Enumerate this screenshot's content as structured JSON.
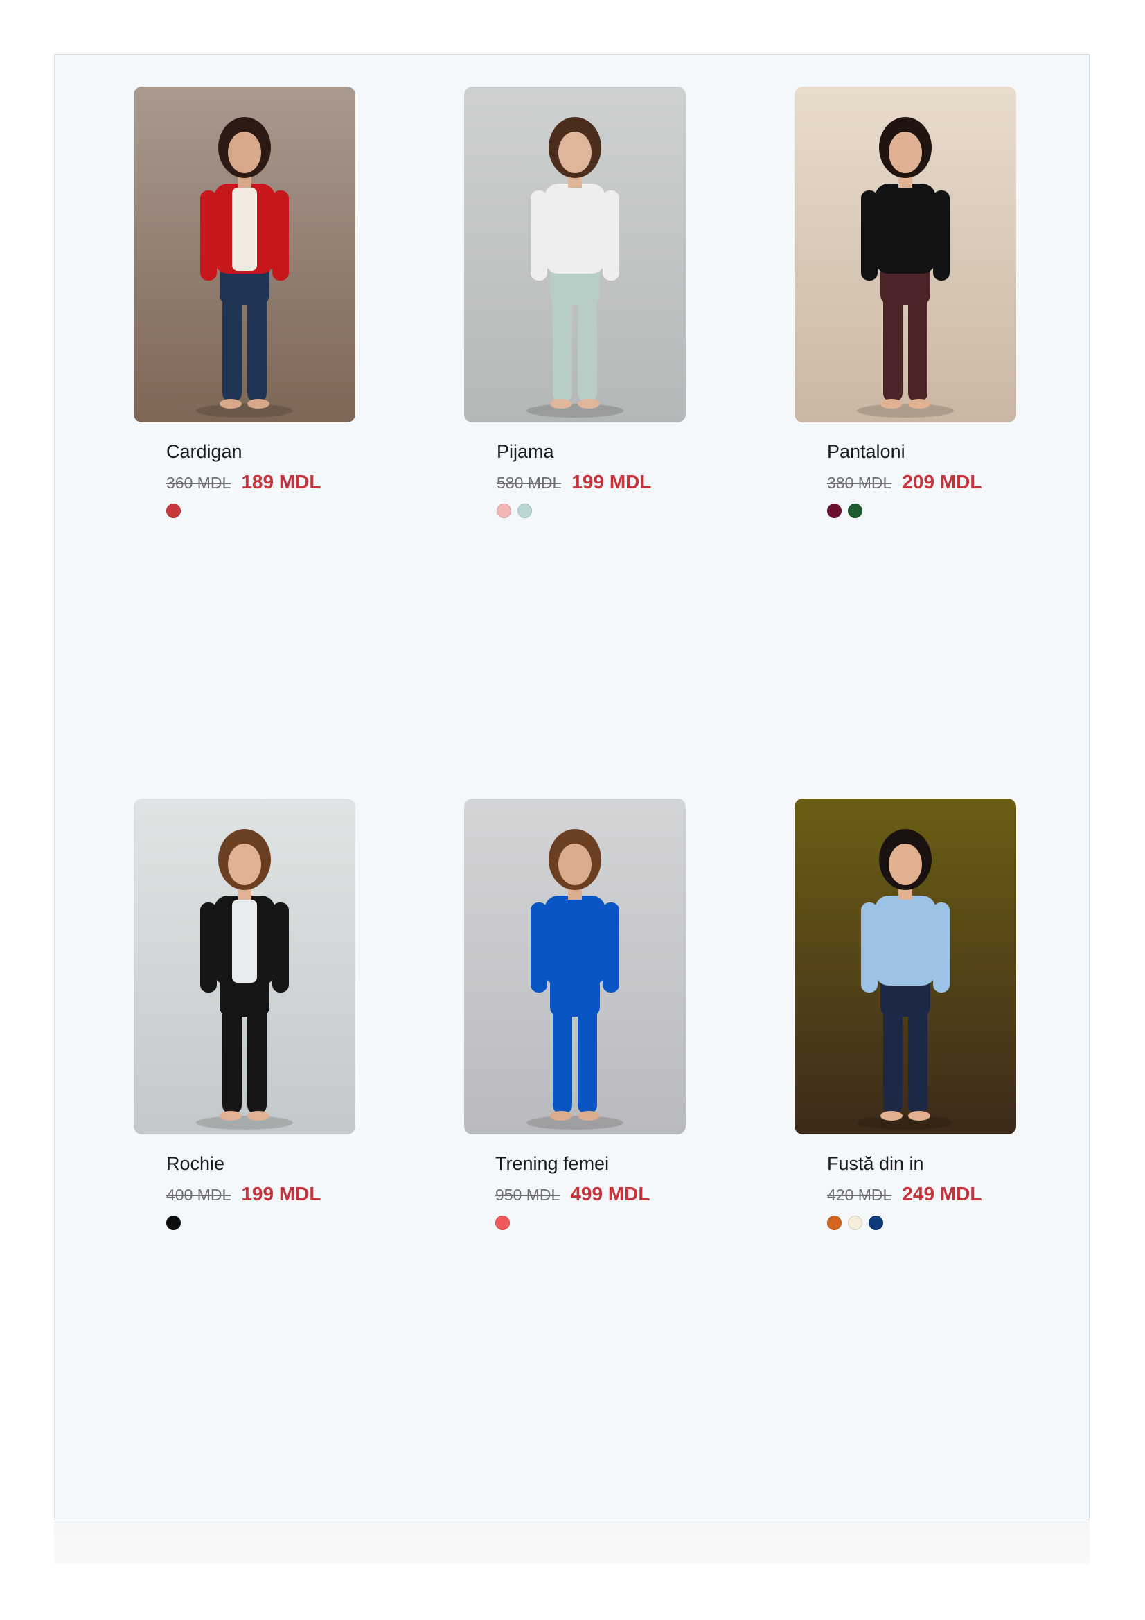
{
  "products": [
    {
      "name": "Cardigan",
      "old_price": "360 MDL",
      "price": "189 MDL",
      "colors": [
        "#c9363c"
      ],
      "photo": {
        "bg_top": "#a89a8f",
        "bg_bottom": "#7d6656",
        "top": "#f2ebe2",
        "outer": "#c8161d",
        "bottom": "#203553",
        "hair": "#2b1b14",
        "skin": "#d8a88a"
      }
    },
    {
      "name": "Pijama",
      "old_price": "580 MDL",
      "price": "199 MDL",
      "colors": [
        "#f4b6b4",
        "#bcd6d8"
      ],
      "photo": {
        "bg_top": "#cfd1d1",
        "bg_bottom": "#b4b7b7",
        "top": "#eeeeec",
        "outer": "",
        "bottom": "#b9cdc8",
        "hair": "#4a2d1c",
        "skin": "#e0b69b"
      }
    },
    {
      "name": "Pantaloni",
      "old_price": "380 MDL",
      "price": "209 MDL",
      "colors": [
        "#6b0f2e",
        "#1d5a2e"
      ],
      "photo": {
        "bg_top": "#e8dccd",
        "bg_bottom": "#c9b7a3",
        "top": "#121214",
        "outer": "",
        "bottom": "#4a2427",
        "hair": "#1f1410",
        "skin": "#e0b293"
      }
    },
    {
      "name": "Rochie",
      "old_price": "400 MDL",
      "price": "199 MDL",
      "colors": [
        "#0d0d0e"
      ],
      "photo": {
        "bg_top": "#dfe3e4",
        "bg_bottom": "#c3c8ca",
        "top": "#e9ecef",
        "outer": "#161617",
        "bottom": "#161617",
        "hair": "#6a3f22",
        "skin": "#e1b293"
      }
    },
    {
      "name": "Trening femei",
      "old_price": "950 MDL",
      "price": "499 MDL",
      "colors": [
        "#f0585a"
      ],
      "photo": {
        "bg_top": "#d3d4d6",
        "bg_bottom": "#b9babd",
        "top": "#0a55c4",
        "outer": "",
        "bottom": "#0a55c4",
        "hair": "#6a3f22",
        "skin": "#dbac8e"
      }
    },
    {
      "name": "Fustă din in",
      "old_price": "420 MDL",
      "price": "249 MDL",
      "colors": [
        "#d2661e",
        "#f5ecd9",
        "#103b7a"
      ],
      "photo": {
        "bg_top": "#6b5e14",
        "bg_bottom": "#3c2a1a",
        "top": "#9cc2e6",
        "outer": "",
        "bottom": "#1c2846",
        "hair": "#1a1210",
        "skin": "#e2b08e"
      }
    }
  ]
}
